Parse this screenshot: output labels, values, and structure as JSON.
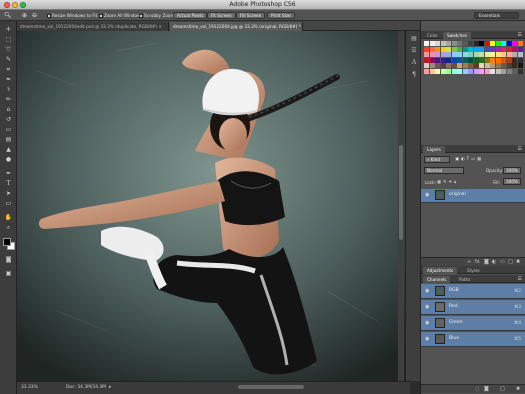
{
  "window": {
    "title": "Adobe Photoshop CS6"
  },
  "options_bar": {
    "resize_windows": "Resize Windows to Fit",
    "zoom_all_windows": "Zoom All Windows",
    "scrubby_zoom": "Scrubby Zoom",
    "actual_pixels": "Actual Pixels",
    "fit_screen": "Fit Screen",
    "fill_screen": "Fill Screen",
    "print_size": "Print Size",
    "workspace": "Essentials"
  },
  "tabs": [
    {
      "label": "dreamstime_xxl_19122004edit.psd @ 33.3% (duplicate, RGB/8#) ×",
      "active": false
    },
    {
      "label": "dreamstime_xxl_19122004.jpg @ 33.3% (original, RGB/8#) *",
      "active": true
    }
  ],
  "status": {
    "zoom": "33.33%",
    "doc": "Doc: 34.3M/34.3M"
  },
  "panels": {
    "color_tab": "Color",
    "swatches_tab": "Swatches",
    "layers_tab": "Layers",
    "kind_filter": "Kind",
    "blend_mode": "Normal",
    "opacity_label": "Opacity:",
    "opacity_value": "100%",
    "lock_label": "Lock:",
    "fill_label": "Fill:",
    "fill_value": "100%",
    "layer_name": "original",
    "adjustments_tab": "Adjustments",
    "styles_tab": "Styles",
    "channels_tab": "Channels",
    "paths_tab": "Paths",
    "channels": [
      {
        "name": "RGB",
        "shortcut": "⌘2"
      },
      {
        "name": "Red",
        "shortcut": "⌘3"
      },
      {
        "name": "Green",
        "shortcut": "⌘4"
      },
      {
        "name": "Blue",
        "shortcut": "⌘5"
      }
    ]
  },
  "colors": {
    "swatch_rows": [
      [
        "#ffffff",
        "#f0f0f0",
        "#d9d9d9",
        "#bfbfbf",
        "#a6a6a6",
        "#8c8c8c",
        "#737373",
        "#595959",
        "#404040",
        "#262626",
        "#000000",
        "#ff0000",
        "#ffff00",
        "#00ff00",
        "#00ffff",
        "#0000ff",
        "#ff00ff",
        "#ff8000"
      ],
      [
        "#ff3b30",
        "#ff6b4a",
        "#ff9500",
        "#ffcc00",
        "#d4e157",
        "#8bc34a",
        "#4caf50",
        "#009688",
        "#00bcd4",
        "#03a9f4",
        "#2196f3",
        "#3f51b5",
        "#673ab7",
        "#9c27b0",
        "#e91e63",
        "#c62828",
        "#ad1457",
        "#6a1b9a"
      ],
      [
        "#ef9a9a",
        "#f48fb1",
        "#ce93d8",
        "#b39ddb",
        "#9fa8da",
        "#90caf9",
        "#81d4fa",
        "#80deea",
        "#80cbc4",
        "#a5d6a7",
        "#c5e1a5",
        "#e6ee9c",
        "#fff59d",
        "#ffe082",
        "#ffcc80",
        "#ffab91",
        "#bcaaa4",
        "#b0bec5"
      ],
      [
        "#b71c1c",
        "#880e4f",
        "#4a148c",
        "#311b92",
        "#1a237e",
        "#0d47a1",
        "#01579b",
        "#006064",
        "#004d40",
        "#1b5e20",
        "#33691e",
        "#827717",
        "#f57f17",
        "#ff6f00",
        "#e65100",
        "#bf360c",
        "#3e2723",
        "#263238"
      ],
      [
        "#d7ccc8",
        "#a1887f",
        "#795548",
        "#5d4037",
        "#8d6e63",
        "#6d4c41",
        "#c8a27c",
        "#a67c52",
        "#7b5b3a",
        "#5a3e25",
        "#e8d5b7",
        "#cfb997",
        "#b29872",
        "#8f7653",
        "#6e5a3e",
        "#4f4030",
        "#332a20",
        "#1a1510"
      ],
      [
        "#ff9999",
        "#ffcc99",
        "#ffff99",
        "#ccff99",
        "#99ff99",
        "#99ffcc",
        "#99ffff",
        "#99ccff",
        "#9999ff",
        "#cc99ff",
        "#ff99ff",
        "#ff99cc",
        "#e0e0e0",
        "#c0c0c0",
        "#a0a0a0",
        "#808080",
        "#606060",
        "#303030"
      ]
    ]
  }
}
